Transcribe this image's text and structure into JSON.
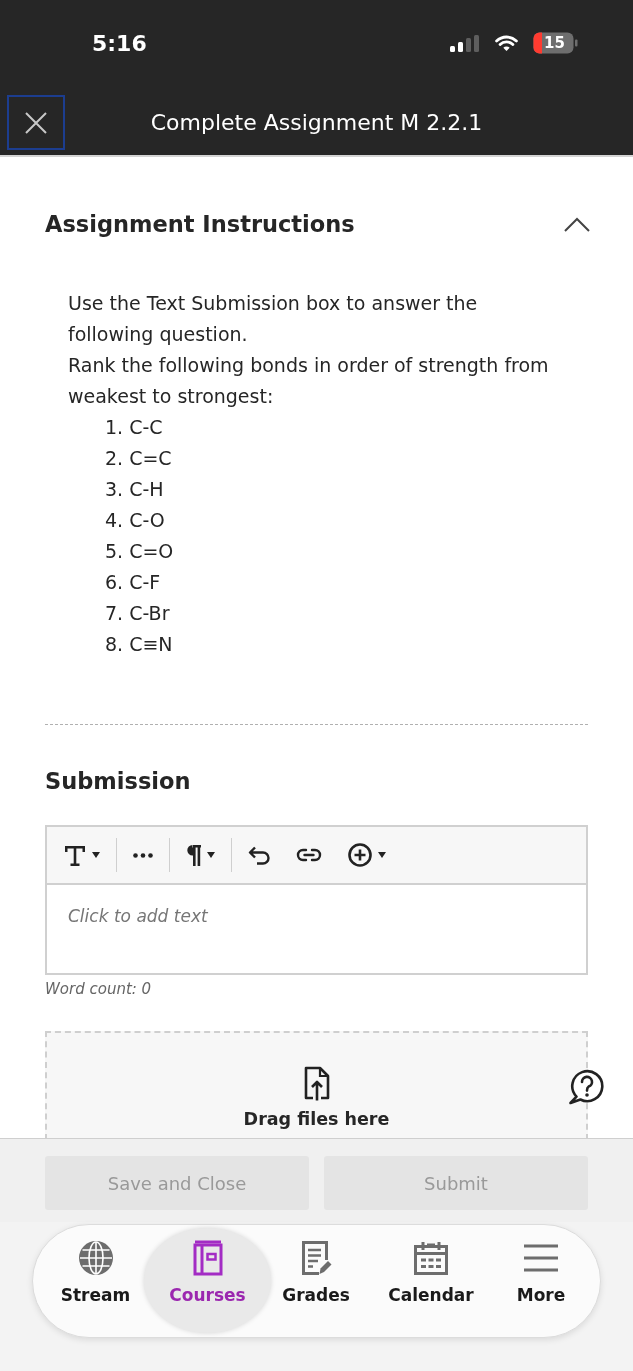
{
  "status_bar": {
    "time": "5:16",
    "battery": "15"
  },
  "header": {
    "title": "Complete Assignment M 2.2.1"
  },
  "instructions": {
    "heading": "Assignment Instructions",
    "expanded": true,
    "paragraphs": [
      "Use the Text Submission box to answer the following question.",
      "Rank the following bonds in order of strength from weakest to strongest:"
    ],
    "list": [
      "1. C-C",
      "2. C=C",
      "3. C-H",
      "4. C-O",
      "5. C=O",
      "6. C-F",
      "7. C-Br",
      "8. C≡N"
    ]
  },
  "submission": {
    "heading": "Submission",
    "toolbar": [
      [
        {
          "kind": "text-style",
          "dropdown": true
        }
      ],
      [
        {
          "kind": "more",
          "dropdown": false
        }
      ],
      [
        {
          "kind": "paragraph",
          "dropdown": true
        }
      ],
      [
        {
          "kind": "undo",
          "dropdown": false
        },
        {
          "kind": "link",
          "dropdown": false
        },
        {
          "kind": "insert",
          "dropdown": true
        }
      ]
    ],
    "placeholder": "Click to add text",
    "word_count": "Word count: 0",
    "drop_zone": "Drag files here"
  },
  "actions": [
    {
      "label": "Save and Close",
      "disabled": true
    },
    {
      "label": "Submit",
      "disabled": true
    }
  ],
  "nav": [
    {
      "kind": "stream",
      "label": "Stream",
      "selected": false
    },
    {
      "kind": "courses",
      "label": "Courses",
      "selected": true
    },
    {
      "kind": "grades",
      "label": "Grades",
      "selected": false
    },
    {
      "kind": "calendar",
      "label": "Calendar",
      "selected": false
    },
    {
      "kind": "more",
      "label": "More",
      "selected": false
    }
  ]
}
